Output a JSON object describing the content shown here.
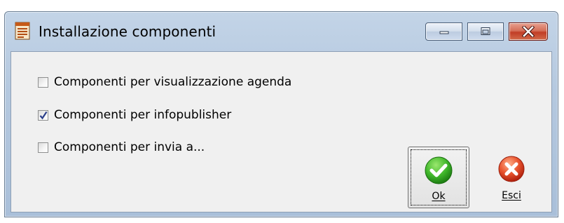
{
  "window": {
    "title": "Installazione componenti",
    "app_icon": "document-icon",
    "controls": [
      "minimize-icon",
      "maximize-icon",
      "close-icon"
    ]
  },
  "options": [
    {
      "label": "Componenti per visualizzazione agenda",
      "checked": false
    },
    {
      "label": "Componenti per infopublisher",
      "checked": true
    },
    {
      "label": "Componenti per invia a...",
      "checked": false
    }
  ],
  "buttons": {
    "ok": {
      "label": "Ok",
      "icon": "check-circle-icon",
      "color": "#2a9d1f"
    },
    "esci": {
      "label": "Esci",
      "icon": "x-circle-icon",
      "color": "#d23a1e"
    }
  }
}
